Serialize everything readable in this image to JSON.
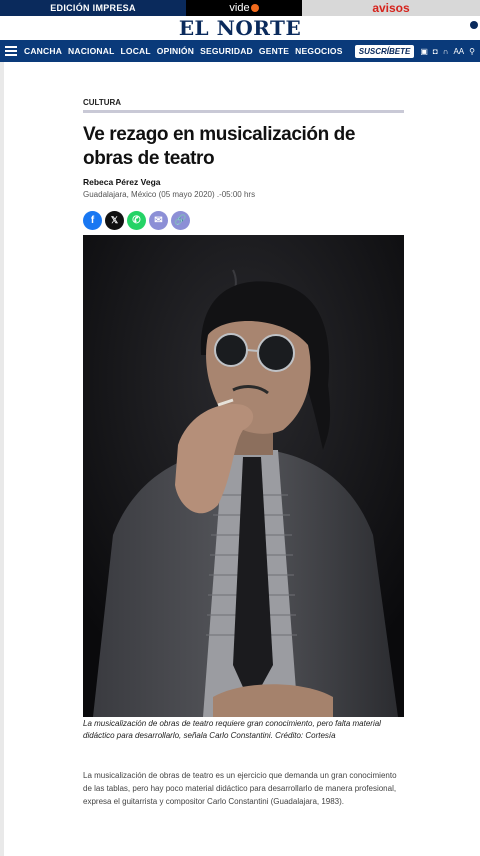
{
  "topbar": {
    "edicion_label": "EDICIÓN IMPRESA",
    "video_label": "vide",
    "avisos_label": "avisos"
  },
  "masthead": {
    "logo": "EL NORTE"
  },
  "nav": {
    "items": [
      "CANCHA",
      "NACIONAL",
      "LOCAL",
      "OPINIÓN",
      "SEGURIDAD",
      "GENTE",
      "NEGOCIOS"
    ],
    "subscribe_label": "SUSCRÍBETE",
    "font_size_label": "AA"
  },
  "article": {
    "section": "CULTURA",
    "headline": "Ve rezago en musicalización de obras de teatro",
    "author": "Rebeca Pérez Vega",
    "dateline": "Guadalajara, México (05 mayo 2020) .-05:00 hrs",
    "caption": "La musicalización de obras de teatro requiere gran conocimiento, pero falta material didáctico para desarrollarlo, señala Carlo Constantini. Crédito: Cortesía",
    "body": "La musicalización de obras de teatro es un ejercicio que demanda un gran conocimiento de las tablas, pero hay poco material didáctico para desarrollarlo de manera profesional, expresa el guitarrista y compositor Carlo Constantini (Guadalajara, 1983)."
  },
  "share": {
    "icons": [
      "facebook-icon",
      "x-icon",
      "whatsapp-icon",
      "email-icon",
      "link-icon"
    ]
  },
  "colors": {
    "brand_navy": "#0a2a5c",
    "nav_blue": "#0a3a7a",
    "avisos_red": "#d6231c",
    "video_orange": "#f26b1d"
  }
}
